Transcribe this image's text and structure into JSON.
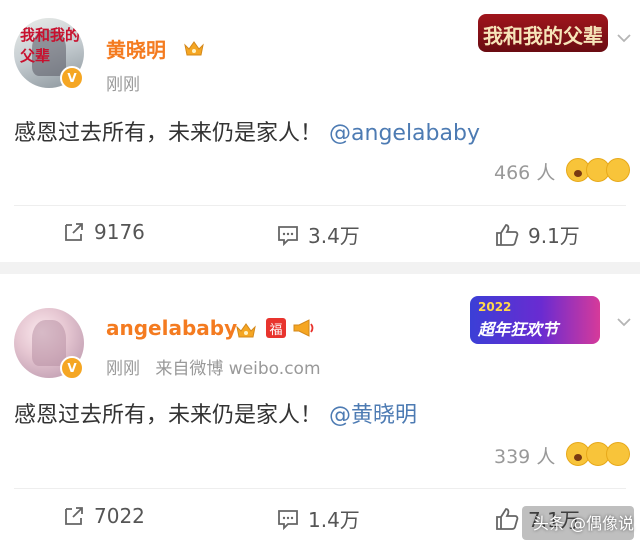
{
  "posts": [
    {
      "user": {
        "name": "黄晓明",
        "avatar_text": "我和我的父辈",
        "verified_badge": "V"
      },
      "meta": {
        "time": "刚刚",
        "source": ""
      },
      "banner": {
        "text": "我和我的父辈"
      },
      "content": {
        "text": "感恩过去所有，未来仍是家人！",
        "mention": "@angelababy"
      },
      "reactions": {
        "count": "466",
        "unit": "人"
      },
      "actions": {
        "share": "9176",
        "comment": "3.4万",
        "like": "9.1万"
      }
    },
    {
      "user": {
        "name": "angelababy",
        "fu_badge": "福",
        "verified_badge": "V"
      },
      "meta": {
        "time": "刚刚",
        "source": "来自微博 weibo.com"
      },
      "banner": {
        "year": "2022",
        "text": "超年狂欢节"
      },
      "content": {
        "text": "感恩过去所有，未来仍是家人！",
        "mention": "@黄晓明"
      },
      "reactions": {
        "count": "339",
        "unit": "人"
      },
      "actions": {
        "share": "7022",
        "comment": "1.4万",
        "like": "7.1万"
      }
    }
  ],
  "watermark": "头条 @偶像说",
  "colors": {
    "name": "#f47b20",
    "mention": "#4d7bb3",
    "meta": "#999999",
    "separator": "#f2f2f2"
  }
}
